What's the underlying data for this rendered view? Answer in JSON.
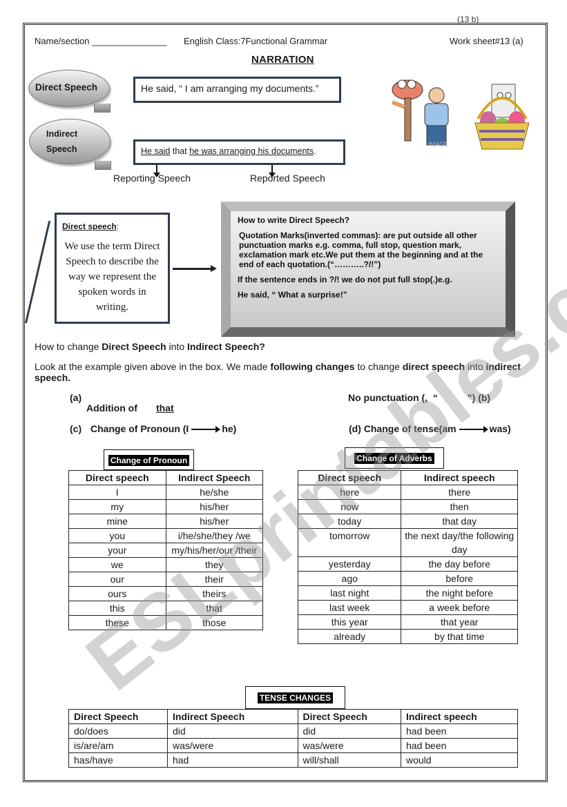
{
  "page_number": "(13 b)",
  "header": {
    "name_label": "Name/section _______________",
    "class_label": "English Class:7Functional Grammar",
    "worksheet": "Work sheet#13 (a)"
  },
  "title": "NARRATION",
  "examples": {
    "direct_bubble": "Direct Speech",
    "indirect_bubble_line1": "Indirect",
    "indirect_bubble_line2": "Speech",
    "direct_sentence": "He said, “ I am arranging my documents.”",
    "indirect_part1": "He said",
    "indirect_part2": " that ",
    "indirect_part3": "he was arranging his documents",
    "indirect_part4": ".",
    "reporting_label": "Reporting Speech",
    "reported_label": "Reported Speech"
  },
  "images": {
    "left": "cartoon-plunger-and-man",
    "right": "cartoon-easter-basket"
  },
  "definition": {
    "title": "Direct speech",
    "title_suffix": ":",
    "text": "We use the term Direct Speech to describe the way we represent the spoken words in writing."
  },
  "how_to_box": {
    "heading": "How to write Direct Speech?",
    "para1": "Quotation Marks(inverted commas): are put outside all other punctuation marks e.g. comma, full stop, question mark, exclamation mark etc.We put them at the beginning and at the end of each quotation.(“………..?/!”)",
    "para2": "If the sentence ends in ?/! we do not put full stop(.)e.g.",
    "para3": "He  said, “ What a surprise!”"
  },
  "change_section": {
    "q_pre": "How to change ",
    "q_b1": "Direct Speech",
    "q_mid": " into ",
    "q_b2": "Indirect Speech?",
    "p_pre": "Look at the example given above in the box. We made ",
    "p_b1": "following changes",
    "p_mid": " to change ",
    "p_b2": "direct speech",
    "p_post": " into ",
    "p_b3": "indirect speech.",
    "a_label": "(a)",
    "a_text": "Addition of",
    "a_word": "that",
    "b_text": "No punctuation (,  “           ”) (b)",
    "c_label": "(c)",
    "c_text": "Change of Pronoun (I",
    "c_to": "he)",
    "d_text": "(d)  Change of tense(am",
    "d_to": "was)"
  },
  "pronoun_table": {
    "caption": "Change of Pronoun",
    "headers": [
      "Direct speech",
      "Indirect Speech"
    ],
    "rows": [
      [
        "I",
        "he/she"
      ],
      [
        "my",
        "his/her"
      ],
      [
        "mine",
        "his/her"
      ],
      [
        "you",
        "i/he/she/they /we"
      ],
      [
        "your",
        "my/his/her/our /their"
      ],
      [
        "we",
        "they"
      ],
      [
        "our",
        "their"
      ],
      [
        "ours",
        "theirs"
      ],
      [
        "this",
        "that"
      ],
      [
        "these",
        "those"
      ]
    ]
  },
  "adverb_table": {
    "caption": "Change of Adverbs",
    "headers": [
      "Direct speech",
      "Indirect speech"
    ],
    "rows": [
      [
        "here",
        "there"
      ],
      [
        "now",
        "then"
      ],
      [
        "today",
        "that day"
      ],
      [
        "tomorrow",
        "the next day/the following day"
      ],
      [
        "yesterday",
        "the day before"
      ],
      [
        "ago",
        "before"
      ],
      [
        "last night",
        "the night before"
      ],
      [
        "last week",
        "a week before"
      ],
      [
        "this year",
        "that year"
      ],
      [
        "already",
        "by that time"
      ]
    ]
  },
  "tense_table": {
    "caption": "TENSE CHANGES",
    "headers": [
      "Direct Speech",
      "Indirect Speech",
      "Direct Speech",
      "Indirect speech"
    ],
    "rows": [
      [
        "do/does",
        "did",
        "did",
        "had been"
      ],
      [
        "is/are/am",
        "was/were",
        "was/were",
        "had been"
      ],
      [
        "has/have",
        "had",
        "will/shall",
        "would"
      ]
    ]
  },
  "watermark": "ESLprintables.com"
}
